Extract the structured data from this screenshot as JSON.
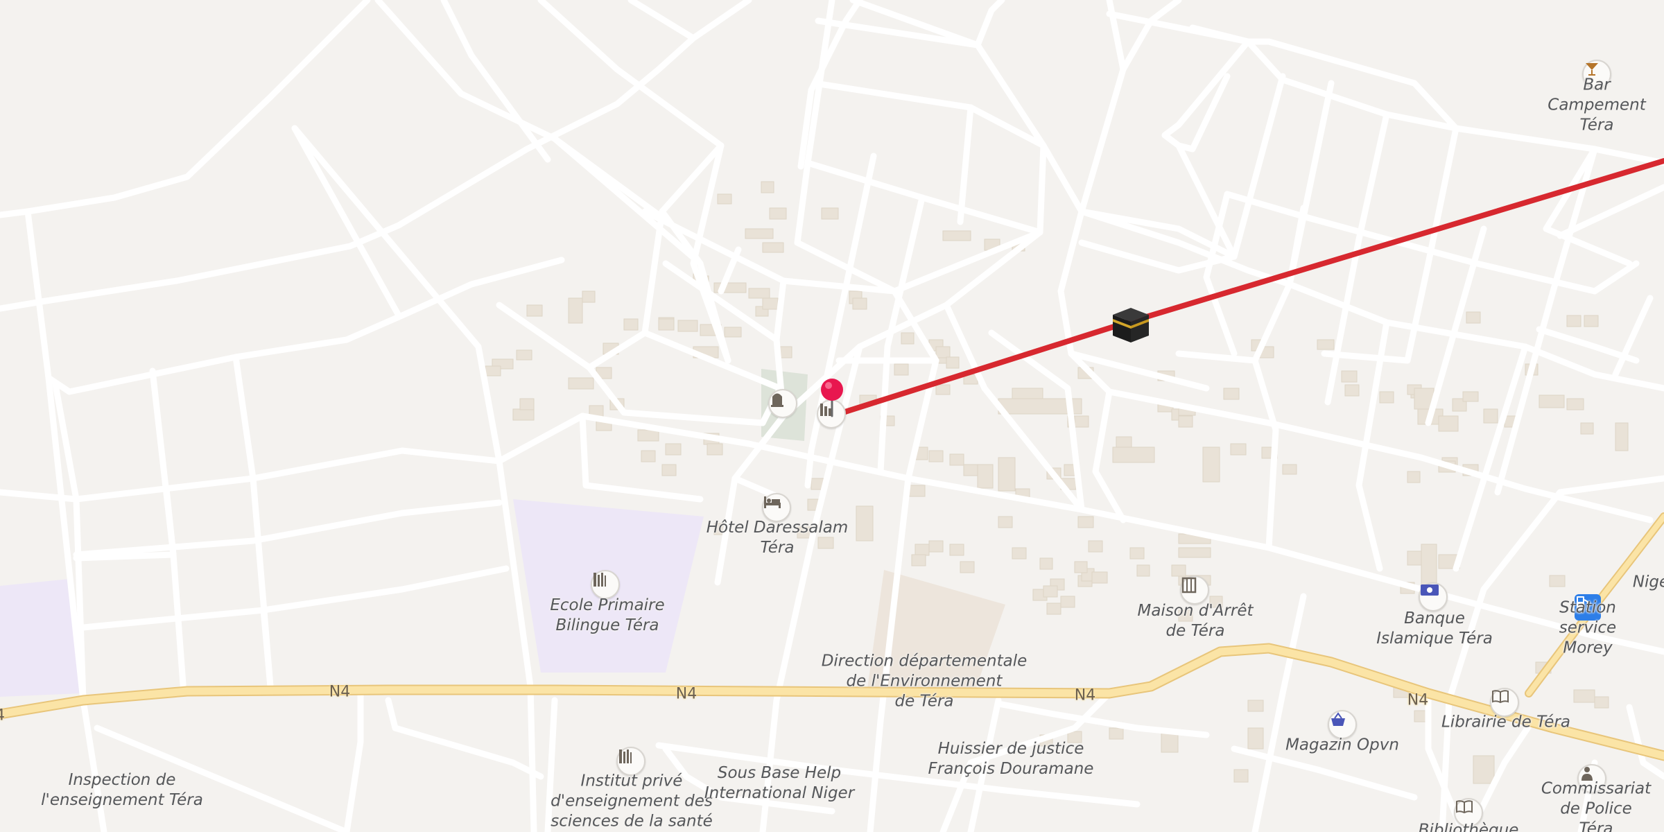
{
  "map": {
    "roads": [
      {
        "name": "N4",
        "label": "N4"
      },
      {
        "name": "N4",
        "label": "N4"
      },
      {
        "name": "N4",
        "label": "N4"
      },
      {
        "name": "N4",
        "label": "N4"
      }
    ],
    "places": [
      {
        "id": "bar-campement",
        "label": "Bar Campement\nTéra",
        "icon": "cocktail-icon"
      },
      {
        "id": "hotel-daressalam",
        "label": "Hôtel Daressalam\nTéra",
        "icon": "bed-icon"
      },
      {
        "id": "ecole-primaire",
        "label": "Ecole Primaire\nBilingue Téra",
        "icon": "school-icon"
      },
      {
        "id": "maison-arret",
        "label": "Maison d'Arrêt\nde Téra",
        "icon": "prison-icon"
      },
      {
        "id": "banque-islamique",
        "label": "Banque\nIslamique Téra",
        "icon": "banknote-icon"
      },
      {
        "id": "station-service",
        "label": "Station service Morey",
        "icon": "fuel-icon"
      },
      {
        "id": "direction-env",
        "label": "Direction départementale\nde l'Environnement\nde Téra",
        "icon": ""
      },
      {
        "id": "huissier",
        "label": "Huissier de justice\nFrançois Douramane",
        "icon": ""
      },
      {
        "id": "magazin-opvn",
        "label": "Magazin Opvn",
        "icon": "shopping-basket-icon"
      },
      {
        "id": "librairie",
        "label": "Librairie de Téra",
        "icon": "book-icon"
      },
      {
        "id": "inspection",
        "label": "Inspection de\nl'enseignement Téra",
        "icon": ""
      },
      {
        "id": "institut-prive",
        "label": "Institut privé\nd'enseignement des\nsciences de la santé",
        "icon": "school-icon"
      },
      {
        "id": "sous-base",
        "label": "Sous Base Help\nInternational Niger",
        "icon": ""
      },
      {
        "id": "commissariat",
        "label": "Commissariat\nde Police Téra",
        "icon": "police-icon"
      },
      {
        "id": "bibliotheque",
        "label": "Bibliothèque",
        "icon": "book-icon"
      },
      {
        "id": "nige-partial",
        "label": "Nige",
        "icon": ""
      }
    ],
    "markers": {
      "pin": {
        "name": "location-pin-icon",
        "color": "#e8174f"
      },
      "kaaba": {
        "name": "kaaba-icon"
      },
      "cemetery": {
        "name": "cemetery-icon"
      },
      "factory": {
        "name": "factory-icon"
      }
    },
    "route": {
      "color": "#d7282f"
    },
    "colors": {
      "background": "#f4f2ef",
      "road": "#ffffff",
      "trunk_road": "#fbe4a6",
      "building": "#e9e2d7",
      "school_area": "#ede7f7",
      "cemetery_area": "#dde3d9"
    }
  }
}
